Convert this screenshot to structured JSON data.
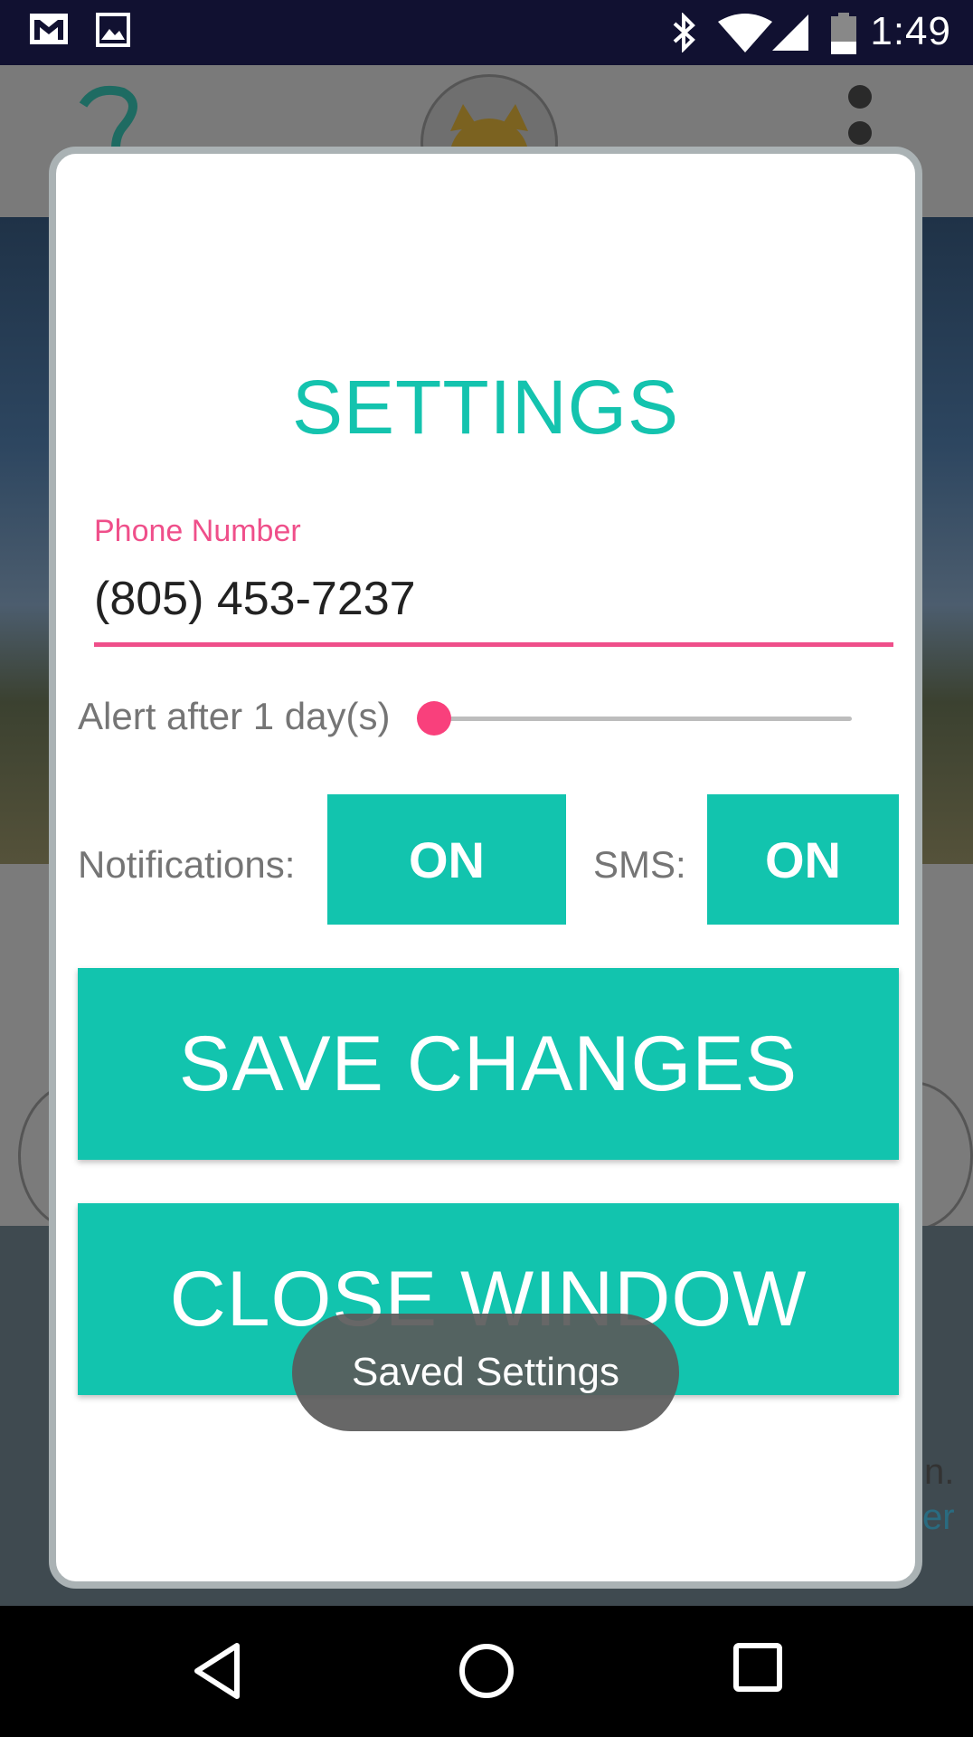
{
  "status_bar": {
    "time": "1:49",
    "icons": [
      "gmail-icon",
      "image-icon",
      "bluetooth-icon",
      "wifi-icon",
      "signal-icon",
      "battery-icon"
    ]
  },
  "dialog": {
    "title": "SETTINGS",
    "phone": {
      "label": "Phone Number",
      "value": "(805) 453-7237"
    },
    "alert": {
      "label": "Alert after 1 day(s)",
      "value_days": 1
    },
    "notifications": {
      "label": "Notifications:",
      "toggle": "ON"
    },
    "sms": {
      "label": "SMS:",
      "toggle": "ON"
    },
    "save_button": "SAVE CHANGES",
    "close_button": "CLOSE WINDOW"
  },
  "toast": {
    "message": "Saved Settings"
  },
  "background": {
    "partial_text_1": "n.",
    "partial_text_2": "er"
  },
  "colors": {
    "accent": "#12c4ae",
    "title": "#14c3ae",
    "phone_accent": "#ef4f8a",
    "slider_thumb": "#f9407c",
    "status_bar": "#111131"
  },
  "nav_bar": {
    "icons": [
      "back-icon",
      "home-icon",
      "recents-icon"
    ]
  }
}
